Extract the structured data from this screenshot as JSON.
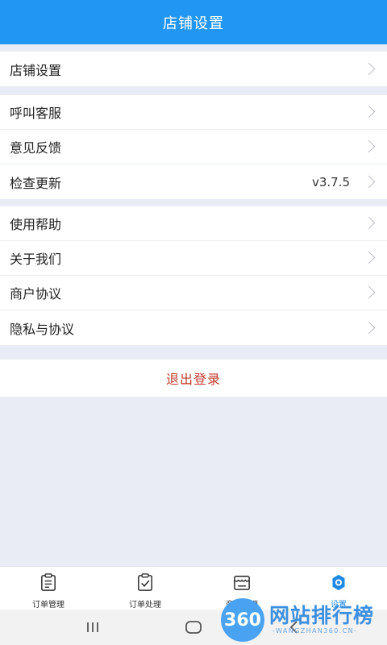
{
  "header": {
    "title": "店铺设置"
  },
  "groups": [
    {
      "items": [
        {
          "label": "店铺设置"
        }
      ]
    },
    {
      "items": [
        {
          "label": "呼叫客服"
        },
        {
          "label": "意见反馈"
        },
        {
          "label": "检查更新",
          "value": "v3.7.5"
        }
      ]
    },
    {
      "items": [
        {
          "label": "使用帮助"
        },
        {
          "label": "关于我们"
        },
        {
          "label": "商户协议"
        },
        {
          "label": "隐私与协议"
        }
      ]
    }
  ],
  "logout": {
    "label": "退出登录"
  },
  "tabbar": {
    "tabs": [
      {
        "label": "订单管理",
        "icon": "clipboard-icon"
      },
      {
        "label": "订单处理",
        "icon": "clipboard-check-icon"
      },
      {
        "label": "商家管理",
        "icon": "storefront-icon"
      },
      {
        "label": "设置",
        "icon": "gear-icon"
      }
    ],
    "active_color": "#1e88e5"
  },
  "watermark": {
    "number": "360",
    "title": "网站排行榜",
    "subtitle": "-WANGZHAN360.CN-"
  },
  "colors": {
    "header": "#2196f3",
    "background": "#e9ecf4",
    "logout_text": "#c0392b"
  }
}
